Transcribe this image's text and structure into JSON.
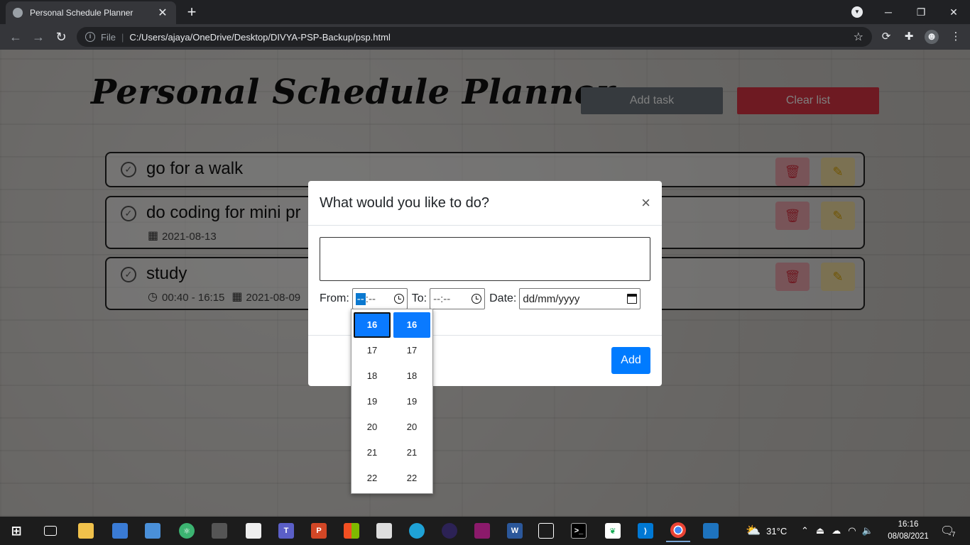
{
  "browser": {
    "tab_title": "Personal Schedule Planner",
    "tab_close": "✕",
    "new_tab": "+",
    "address_scheme": "File",
    "address_url": "C:/Users/ajaya/OneDrive/Desktop/DIVYA-PSP-Backup/psp.html"
  },
  "app": {
    "title": "Personal Schedule Planner",
    "add_task_label": "Add task",
    "clear_list_label": "Clear list"
  },
  "tasks": [
    {
      "name": "go for a walk",
      "time": "",
      "date": ""
    },
    {
      "name": "do coding for mini pr",
      "time": "",
      "date": "2021-08-13"
    },
    {
      "name": "study",
      "time": "00:40 - 16:15",
      "date": "2021-08-09"
    }
  ],
  "modal": {
    "title": "What would you like to do?",
    "close": "×",
    "task_value": "",
    "from_label": "From:",
    "from_value_hh": "--",
    "from_value_rest": ":--",
    "to_label": "To:",
    "to_value": "--:--",
    "date_label": "Date:",
    "date_value": "dd/mm/yyyy",
    "add_label": "Add"
  },
  "time_picker": {
    "hours": [
      "16",
      "17",
      "18",
      "19",
      "20",
      "21",
      "22"
    ],
    "minutes": [
      "16",
      "17",
      "18",
      "19",
      "20",
      "21",
      "22"
    ],
    "selected_hour": "16",
    "selected_minute": "16"
  },
  "taskbar": {
    "weather_temp": "31°C",
    "time": "16:16",
    "date": "08/08/2021",
    "notification_count": "7"
  },
  "colors": {
    "add_task_button": "#6c757d",
    "clear_list_button": "#dc3545",
    "modal_add_button": "#007bff",
    "picker_selected": "#0a7aff"
  }
}
